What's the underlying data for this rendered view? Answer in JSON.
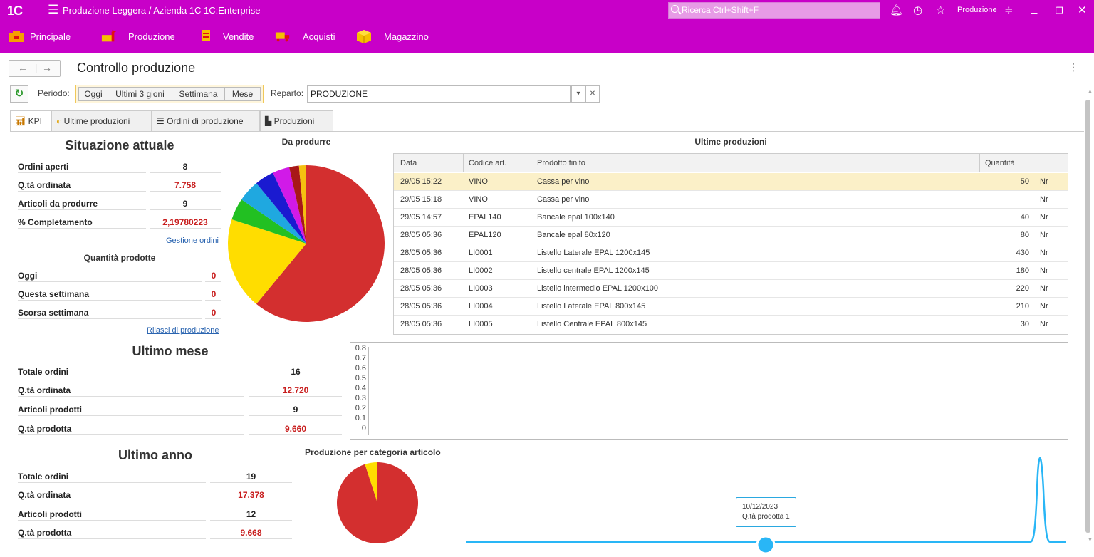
{
  "app": {
    "logo": "1С",
    "title": "Produzione Leggera / Azienda 1C 1C:Enterprise",
    "search_placeholder": "Ricerca Ctrl+Shift+F",
    "user": "Produzione",
    "brand_color": "#c800c8"
  },
  "menu": [
    {
      "label": "Principale",
      "icon": "home-icon"
    },
    {
      "label": "Produzione",
      "icon": "production-icon"
    },
    {
      "label": "Vendite",
      "icon": "sales-icon"
    },
    {
      "label": "Acquisti",
      "icon": "truck-icon"
    },
    {
      "label": "Magazzino",
      "icon": "warehouse-box-icon"
    }
  ],
  "page": {
    "title": "Controllo produzione",
    "periodo_label": "Periodo:",
    "period_buttons": [
      "Oggi",
      "Ultimi 3 gioni",
      "Settimana",
      "Mese"
    ],
    "reparto_label": "Reparto:",
    "reparto_value": "PRODUZIONE"
  },
  "tabs": [
    {
      "label": "KPI",
      "icon": "chart-icon"
    },
    {
      "label": "Ultime produzioni",
      "icon": "production-cycle-icon"
    },
    {
      "label": "Ordini di produzione",
      "icon": "list-icon"
    },
    {
      "label": "Produzioni",
      "icon": "factory-icon"
    }
  ],
  "situazione": {
    "title": "Situazione attuale",
    "rows": [
      {
        "label": "Ordini aperti",
        "value": "8"
      },
      {
        "label": "Q.tà ordinata",
        "value": "7.758"
      },
      {
        "label": "Articoli da produrre",
        "value": "9"
      },
      {
        "label": "% Completamento",
        "value": "2,19780223"
      }
    ],
    "link": "Gestione ordini"
  },
  "quantita": {
    "title": "Quantità prodotte",
    "rows": [
      {
        "label": "Oggi",
        "value": "0"
      },
      {
        "label": "Questa settimana",
        "value": "0"
      },
      {
        "label": "Scorsa settimana",
        "value": "0"
      }
    ],
    "link": "Rilasci di produzione"
  },
  "ultimo_mese": {
    "title": "Ultimo mese",
    "rows": [
      {
        "label": "Totale ordini",
        "value": "16"
      },
      {
        "label": "Q.tà ordinata",
        "value": "12.720"
      },
      {
        "label": "Articoli prodotti",
        "value": "9"
      },
      {
        "label": "Q.tà prodotta",
        "value": "9.660"
      }
    ]
  },
  "ultimo_anno": {
    "title": "Ultimo anno",
    "rows": [
      {
        "label": "Totale ordini",
        "value": "19"
      },
      {
        "label": "Q.tà ordinata",
        "value": "17.378"
      },
      {
        "label": "Articoli prodotti",
        "value": "12"
      },
      {
        "label": "Q.tà prodotta",
        "value": "9.668"
      }
    ]
  },
  "ultime_produzioni": {
    "title": "Ultime produzioni",
    "columns": [
      "Data",
      "Codice art.",
      "Prodotto finito",
      "Quantità"
    ],
    "rows": [
      {
        "data": "29/05 15:22",
        "codice": "VINO",
        "prodotto": "Cassa per vino",
        "qta": "50",
        "um": "Nr"
      },
      {
        "data": "29/05 15:18",
        "codice": "VINO",
        "prodotto": "Cassa per vino",
        "qta": "",
        "um": "Nr"
      },
      {
        "data": "29/05 14:57",
        "codice": "EPAL140",
        "prodotto": "Bancale epal 100x140",
        "qta": "40",
        "um": "Nr"
      },
      {
        "data": "28/05 05:36",
        "codice": "EPAL120",
        "prodotto": "Bancale epal 80x120",
        "qta": "80",
        "um": "Nr"
      },
      {
        "data": "28/05 05:36",
        "codice": "LI0001",
        "prodotto": "Listello Laterale EPAL 1200x145",
        "qta": "430",
        "um": "Nr"
      },
      {
        "data": "28/05 05:36",
        "codice": "LI0002",
        "prodotto": "Listello centrale EPAL 1200x145",
        "qta": "180",
        "um": "Nr"
      },
      {
        "data": "28/05 05:36",
        "codice": "LI0003",
        "prodotto": "Listello intermedio EPAL 1200x100",
        "qta": "220",
        "um": "Nr"
      },
      {
        "data": "28/05 05:36",
        "codice": "LI0004",
        "prodotto": "Listello Laterale EPAL 800x145",
        "qta": "210",
        "um": "Nr"
      },
      {
        "data": "28/05 05:36",
        "codice": "LI0005",
        "prodotto": "Listello Centrale EPAL 800x145",
        "qta": "30",
        "um": "Nr"
      }
    ]
  },
  "chart_data": [
    {
      "type": "pie",
      "title": "Da produrre",
      "slices": [
        {
          "color": "#d32f2f",
          "value": 61
        },
        {
          "color": "#ffdd00",
          "value": 19
        },
        {
          "color": "#22c022",
          "value": 4.5
        },
        {
          "color": "#1fa8e0",
          "value": 4.5
        },
        {
          "color": "#1a1ad0",
          "value": 4
        },
        {
          "color": "#d11ae8",
          "value": 3.5
        },
        {
          "color": "#a81818",
          "value": 2
        },
        {
          "color": "#f5c010",
          "value": 1.5
        }
      ]
    },
    {
      "type": "line",
      "title": "",
      "yticks": [
        "0.8",
        "0.7",
        "0.6",
        "0.5",
        "0.4",
        "0.3",
        "0.2",
        "0.1",
        "0"
      ],
      "ylim": [
        0,
        0.8
      ],
      "series": []
    },
    {
      "type": "pie",
      "title": "Produzione per categoria articolo",
      "slices": [
        {
          "color": "#d32f2f",
          "value": 95
        },
        {
          "color": "#ffdd00",
          "value": 5
        }
      ]
    },
    {
      "type": "line",
      "title": "",
      "color": "#29b6f6",
      "tooltip": {
        "date": "10/12/2023",
        "label": "Q.tà prodotta 1"
      }
    }
  ]
}
